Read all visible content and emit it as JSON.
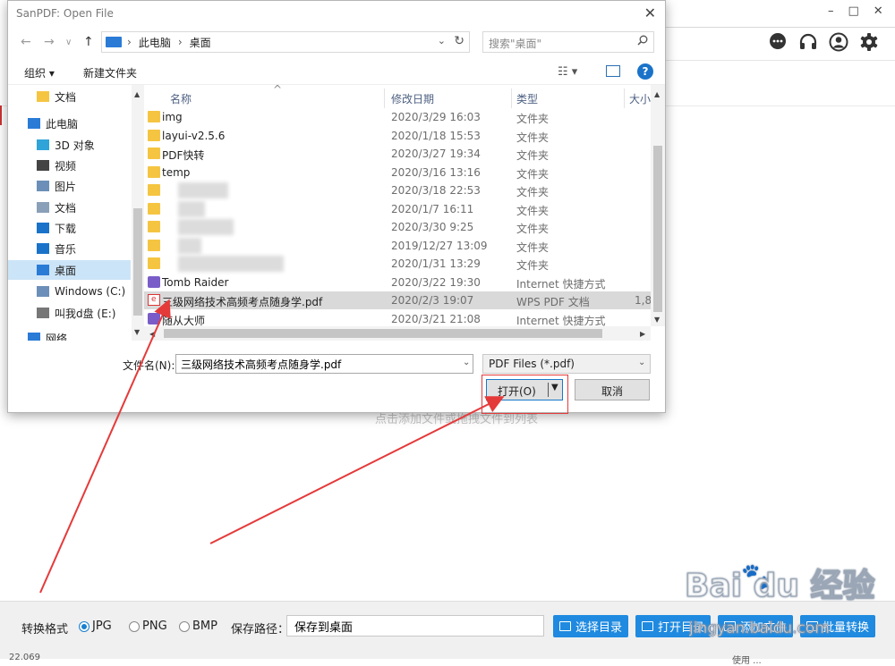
{
  "app": {
    "window_buttons": [
      "–",
      "□",
      "✕"
    ],
    "drop_hint": "点击添加文件或拖拽文件到列表",
    "format_label": "转换格式",
    "formats": [
      {
        "label": "JPG",
        "selected": true
      },
      {
        "label": "PNG",
        "selected": false
      },
      {
        "label": "BMP",
        "selected": false
      }
    ],
    "save_path_label": "保存路径：",
    "save_path_value": "保存到桌面",
    "buttons": {
      "choose_dir": "选择目录",
      "open_dir": "打开目录",
      "add_file": "添加文件",
      "batch_convert": "批量转换"
    },
    "status_left": "22.069",
    "status_right": "使用 ..."
  },
  "watermark": {
    "main": "Bai du 经验",
    "sub": "jingyan.baidu.com"
  },
  "dialog": {
    "title": "SanPDF: Open File",
    "address": [
      "此电脑",
      "桌面"
    ],
    "search_placeholder": "搜索\"桌面\"",
    "toolbar": {
      "organize": "组织 ▾",
      "new_folder": "新建文件夹"
    },
    "sidebar": [
      {
        "label": "文档",
        "icon": "folder-icon",
        "color": "#f5c542",
        "selected": false
      },
      {
        "label": "此电脑",
        "icon": "computer-icon",
        "color": "#2a7bd6",
        "selected": false
      },
      {
        "label": "3D 对象",
        "icon": "cube-icon",
        "color": "#2fa4d8",
        "selected": false
      },
      {
        "label": "视频",
        "icon": "video-icon",
        "color": "#444444",
        "selected": false
      },
      {
        "label": "图片",
        "icon": "picture-icon",
        "color": "#6b8fb8",
        "selected": false
      },
      {
        "label": "文档",
        "icon": "document-icon",
        "color": "#8aa0b8",
        "selected": false
      },
      {
        "label": "下载",
        "icon": "download-icon",
        "color": "#1a73c9",
        "selected": false
      },
      {
        "label": "音乐",
        "icon": "music-icon",
        "color": "#1a73c9",
        "selected": false
      },
      {
        "label": "桌面",
        "icon": "desktop-icon",
        "color": "#2a7bd6",
        "selected": true
      },
      {
        "label": "Windows (C:)",
        "icon": "drive-icon",
        "color": "#6b8fb8",
        "selected": false
      },
      {
        "label": "叫我d盘 (E:)",
        "icon": "drive-icon",
        "color": "#777777",
        "selected": false
      },
      {
        "label": "网络",
        "icon": "network-icon",
        "color": "#2a7bd6",
        "selected": false
      }
    ],
    "columns": {
      "name": "名称",
      "date": "修改日期",
      "type": "类型",
      "size": "大小"
    },
    "files": [
      {
        "name": "img",
        "date": "2020/3/29 16:03",
        "type": "文件夹",
        "size": "",
        "icon": "folder-icon",
        "blurred": false,
        "selected": false
      },
      {
        "name": "layui-v2.5.6",
        "date": "2020/1/18 15:53",
        "type": "文件夹",
        "size": "",
        "icon": "folder-icon",
        "blurred": false,
        "selected": false
      },
      {
        "name": "PDF快转",
        "date": "2020/3/27 19:34",
        "type": "文件夹",
        "size": "",
        "icon": "folder-icon",
        "blurred": false,
        "selected": false
      },
      {
        "name": "temp",
        "date": "2020/3/16 13:16",
        "type": "文件夹",
        "size": "",
        "icon": "folder-icon",
        "blurred": false,
        "selected": false
      },
      {
        "name": "",
        "date": "2020/3/18 22:53",
        "type": "文件夹",
        "size": "",
        "icon": "folder-icon",
        "blurred": true,
        "selected": false
      },
      {
        "name": "",
        "date": "2020/1/7 16:11",
        "type": "文件夹",
        "size": "",
        "icon": "folder-icon",
        "blurred": true,
        "selected": false
      },
      {
        "name": "",
        "date": "2020/3/30 9:25",
        "type": "文件夹",
        "size": "",
        "icon": "folder-icon",
        "blurred": true,
        "selected": false
      },
      {
        "name": "",
        "date": "2019/12/27 13:09",
        "type": "文件夹",
        "size": "",
        "icon": "folder-icon",
        "blurred": true,
        "selected": false
      },
      {
        "name": "",
        "date": "2020/1/31 13:29",
        "type": "文件夹",
        "size": "",
        "icon": "folder-icon",
        "blurred": true,
        "selected": false
      },
      {
        "name": "Tomb Raider",
        "date": "2020/3/22 19:30",
        "type": "Internet 快捷方式",
        "size": "",
        "icon": "shortcut-icon",
        "blurred": false,
        "selected": false
      },
      {
        "name": "三级网络技术高频考点随身学.pdf",
        "date": "2020/2/3 19:07",
        "type": "WPS PDF 文档",
        "size": "1,8",
        "icon": "pdf-icon",
        "blurred": false,
        "selected": true
      },
      {
        "name": "随从大师",
        "date": "2020/3/21 21:08",
        "type": "Internet 快捷方式",
        "size": "",
        "icon": "shortcut-icon",
        "blurred": false,
        "selected": false
      }
    ],
    "filename_label": "文件名(N):",
    "filename_value": "三级网络技术高频考点随身学.pdf",
    "filetype_value": "PDF Files (*.pdf)",
    "open_label": "打开(O)",
    "cancel_label": "取消"
  },
  "colors": {
    "accent": "#1f8ae0",
    "annotation": "#e53a3a",
    "selection": "#cce4f7"
  }
}
